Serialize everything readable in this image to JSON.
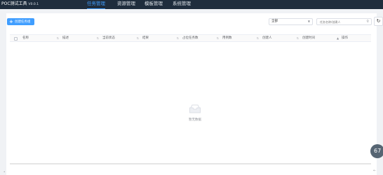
{
  "app": {
    "title": "POC测试工具",
    "version": "V0.0.1"
  },
  "nav": [
    "任务管理",
    "资源管理",
    "模板管理",
    "系统管理"
  ],
  "toolbar": {
    "create_label": "创建任务组",
    "filter_value": "全部",
    "search_placeholder": "任务名称/创建人"
  },
  "table": {
    "columns": [
      "名称",
      "描述",
      "当前状态",
      "结果",
      "占位任务数",
      "用例数",
      "创建人",
      "创建时间",
      "操作"
    ],
    "empty_text": "暂无数据"
  },
  "badge": {
    "value": "67"
  },
  "colors": {
    "accent": "#409eff",
    "topbar": "#1f2d3d"
  }
}
